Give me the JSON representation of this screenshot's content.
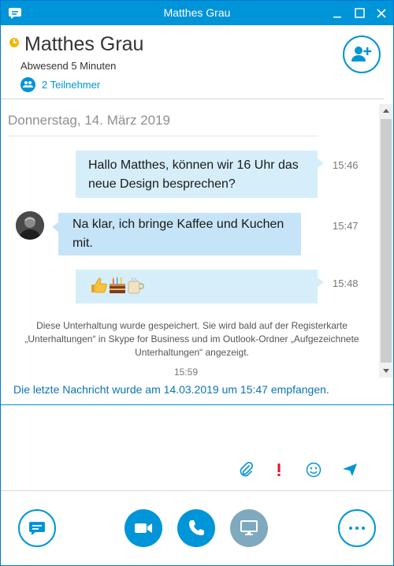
{
  "window": {
    "title": "Matthes Grau",
    "accent_color": "#0094d8"
  },
  "header": {
    "contact_name": "Matthes Grau",
    "presence_status": "Abwesend 5 Minuten",
    "presence_color": "#f2b700",
    "participants_label": "2 Teilnehmer"
  },
  "conversation": {
    "date": "Donnerstag, 14. März 2019",
    "messages": [
      {
        "direction": "outgoing",
        "text": "Hallo Matthes, können wir 16 Uhr das neue Design besprechen?",
        "time": "15:46"
      },
      {
        "direction": "incoming",
        "text": "Na klar, ich bringe Kaffee und Kuchen mit.",
        "time": "15:47"
      },
      {
        "direction": "outgoing",
        "emojis": [
          "thumbs-up-icon",
          "cake-icon",
          "coffee-icon"
        ],
        "time": "15:48"
      }
    ],
    "saved_notice": "Diese Unterhaltung wurde gespeichert. Sie wird bald auf der Registerkarte „Unterhaltungen“ in Skype for Business und im Outlook-Ordner „Aufgezeichnete Unterhaltungen“ angezeigt.",
    "last_time": "15:59",
    "last_received": "Die letzte Nachricht wurde am 14.03.2019 um 15:47 empfangen."
  },
  "compose": {
    "value": ""
  }
}
